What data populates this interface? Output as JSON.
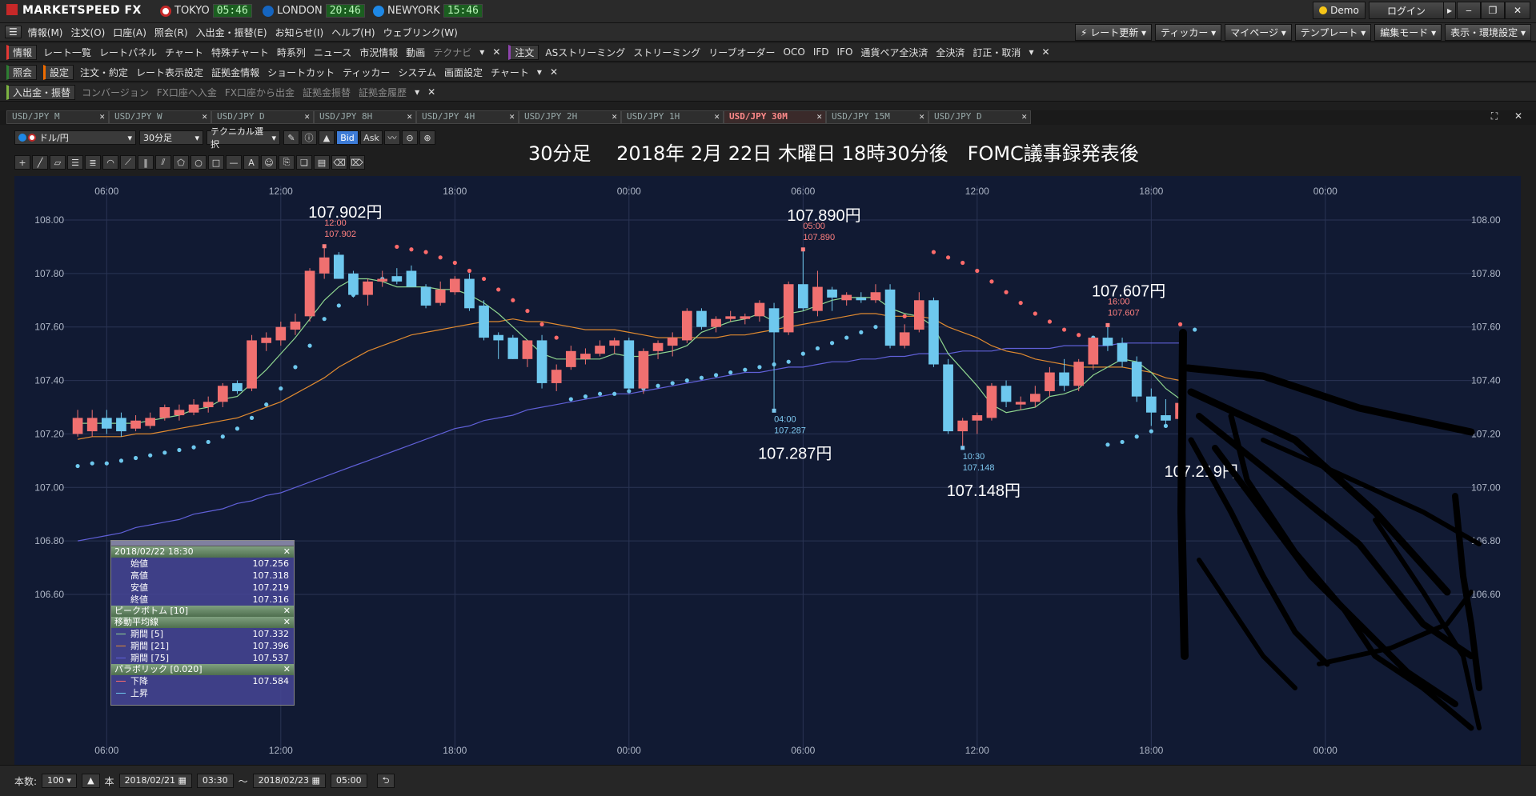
{
  "app": {
    "name": "MARKETSPEED FX",
    "clocks": [
      {
        "city": "TOKYO",
        "time": "05:46",
        "flag_color": "#c62828"
      },
      {
        "city": "LONDON",
        "time": "20:46",
        "flag_color": "#1565c0"
      },
      {
        "city": "NEWYORK",
        "time": "15:46",
        "flag_color": "#1e88e5"
      }
    ],
    "demo_label": "Demo",
    "login_label": "ログイン",
    "menu": [
      "情報(M)",
      "注文(O)",
      "口座(A)",
      "照会(R)",
      "入出金・振替(E)",
      "お知らせ(I)",
      "ヘルプ(H)",
      "ウェブリンク(W)"
    ],
    "right_buttons": [
      "レート更新",
      "ティッカー",
      "マイページ",
      "テンプレート",
      "編集モード",
      "表示・環境設定"
    ]
  },
  "toolbar1": {
    "section1_label": "情報",
    "items1": [
      "レート一覧",
      "レートパネル",
      "チャート",
      "特殊チャート",
      "時系列",
      "ニュース",
      "市況情報",
      "動画"
    ],
    "dim_item": "テクナビ",
    "section2_label": "注文",
    "items2": [
      "ASストリーミング",
      "ストリーミング",
      "リーブオーダー",
      "OCO",
      "IFD",
      "IFO",
      "通貨ペア全決済",
      "全決済",
      "訂正・取消"
    ]
  },
  "toolbar2": {
    "section1_label": "照会",
    "section2_label": "設定",
    "items": [
      "注文・約定",
      "レート表示設定",
      "証拠金情報",
      "ショートカット",
      "ティッカー",
      "システム",
      "画面設定",
      "チャート"
    ]
  },
  "toolbar3": {
    "section_label": "入出金・振替",
    "items": [
      "コンバージョン",
      "FX口座へ入金",
      "FX口座から出金",
      "証拠金振替",
      "証拠金履歴"
    ]
  },
  "tabs": [
    {
      "label": "USD/JPY M",
      "active": false
    },
    {
      "label": "USD/JPY W",
      "active": false
    },
    {
      "label": "USD/JPY D",
      "active": false
    },
    {
      "label": "USD/JPY 8H",
      "active": false
    },
    {
      "label": "USD/JPY 4H",
      "active": false
    },
    {
      "label": "USD/JPY 2H",
      "active": false
    },
    {
      "label": "USD/JPY 1H",
      "active": false
    },
    {
      "label": "USD/JPY 30M",
      "active": true
    },
    {
      "label": "USD/JPY 15M",
      "active": false
    },
    {
      "label": "USD/JPY D",
      "active": false
    }
  ],
  "chart_toolbar": {
    "pair": "ドル/円",
    "timeframe": "30分足",
    "technical": "テクニカル選択",
    "bid": "Bid",
    "ask": "Ask"
  },
  "chart_title": "30分足　 2018年 2月 22日 木曜日 18時30分後　FOMC議事録発表後",
  "chart_data": {
    "type": "candlestick",
    "ylim": [
      106.5,
      108.1
    ],
    "yticks": [
      106.6,
      106.8,
      107.0,
      107.2,
      107.4,
      107.6,
      107.8,
      108.0
    ],
    "ytick_labels": [
      "106.60",
      "106.80",
      "107.00",
      "107.20",
      "107.40",
      "107.60",
      "107.80",
      "108.00"
    ],
    "xtick_labels": [
      "06:00",
      "12:00",
      "18:00",
      "00:00",
      "06:00",
      "12:00",
      "18:00",
      "00:00"
    ],
    "xtick_index": [
      2,
      14,
      26,
      38,
      50,
      62,
      74,
      86
    ],
    "n_slots": 96,
    "candles": [
      {
        "o": 107.2,
        "h": 107.29,
        "l": 107.19,
        "c": 107.26
      },
      {
        "o": 107.21,
        "h": 107.29,
        "l": 107.19,
        "c": 107.26
      },
      {
        "o": 107.26,
        "h": 107.29,
        "l": 107.2,
        "c": 107.22
      },
      {
        "o": 107.26,
        "h": 107.28,
        "l": 107.19,
        "c": 107.21
      },
      {
        "o": 107.22,
        "h": 107.27,
        "l": 107.21,
        "c": 107.25
      },
      {
        "o": 107.23,
        "h": 107.28,
        "l": 107.22,
        "c": 107.26
      },
      {
        "o": 107.26,
        "h": 107.31,
        "l": 107.25,
        "c": 107.3
      },
      {
        "o": 107.27,
        "h": 107.31,
        "l": 107.25,
        "c": 107.29
      },
      {
        "o": 107.28,
        "h": 107.33,
        "l": 107.27,
        "c": 107.31
      },
      {
        "o": 107.3,
        "h": 107.34,
        "l": 107.28,
        "c": 107.32
      },
      {
        "o": 107.32,
        "h": 107.39,
        "l": 107.3,
        "c": 107.38
      },
      {
        "o": 107.39,
        "h": 107.4,
        "l": 107.35,
        "c": 107.36
      },
      {
        "o": 107.37,
        "h": 107.57,
        "l": 107.36,
        "c": 107.55
      },
      {
        "o": 107.54,
        "h": 107.58,
        "l": 107.51,
        "c": 107.56
      },
      {
        "o": 107.55,
        "h": 107.62,
        "l": 107.53,
        "c": 107.6
      },
      {
        "o": 107.59,
        "h": 107.65,
        "l": 107.57,
        "c": 107.62
      },
      {
        "o": 107.64,
        "h": 107.82,
        "l": 107.62,
        "c": 107.81
      },
      {
        "o": 107.8,
        "h": 107.902,
        "l": 107.78,
        "c": 107.86
      },
      {
        "o": 107.87,
        "h": 107.88,
        "l": 107.78,
        "c": 107.78
      },
      {
        "o": 107.8,
        "h": 107.81,
        "l": 107.71,
        "c": 107.72
      },
      {
        "o": 107.72,
        "h": 107.78,
        "l": 107.68,
        "c": 107.77
      },
      {
        "o": 107.77,
        "h": 107.81,
        "l": 107.75,
        "c": 107.78
      },
      {
        "o": 107.79,
        "h": 107.82,
        "l": 107.76,
        "c": 107.77
      },
      {
        "o": 107.81,
        "h": 107.83,
        "l": 107.75,
        "c": 107.75
      },
      {
        "o": 107.75,
        "h": 107.76,
        "l": 107.67,
        "c": 107.68
      },
      {
        "o": 107.69,
        "h": 107.77,
        "l": 107.68,
        "c": 107.74
      },
      {
        "o": 107.73,
        "h": 107.79,
        "l": 107.72,
        "c": 107.78
      },
      {
        "o": 107.78,
        "h": 107.8,
        "l": 107.66,
        "c": 107.67
      },
      {
        "o": 107.68,
        "h": 107.7,
        "l": 107.55,
        "c": 107.56
      },
      {
        "o": 107.57,
        "h": 107.58,
        "l": 107.48,
        "c": 107.55
      },
      {
        "o": 107.56,
        "h": 107.57,
        "l": 107.48,
        "c": 107.48
      },
      {
        "o": 107.48,
        "h": 107.55,
        "l": 107.45,
        "c": 107.55
      },
      {
        "o": 107.55,
        "h": 107.57,
        "l": 107.37,
        "c": 107.39
      },
      {
        "o": 107.39,
        "h": 107.46,
        "l": 107.36,
        "c": 107.44
      },
      {
        "o": 107.45,
        "h": 107.53,
        "l": 107.44,
        "c": 107.51
      },
      {
        "o": 107.48,
        "h": 107.52,
        "l": 107.46,
        "c": 107.5
      },
      {
        "o": 107.5,
        "h": 107.55,
        "l": 107.49,
        "c": 107.53
      },
      {
        "o": 107.53,
        "h": 107.56,
        "l": 107.5,
        "c": 107.55
      },
      {
        "o": 107.55,
        "h": 107.56,
        "l": 107.36,
        "c": 107.37
      },
      {
        "o": 107.37,
        "h": 107.52,
        "l": 107.35,
        "c": 107.51
      },
      {
        "o": 107.51,
        "h": 107.55,
        "l": 107.48,
        "c": 107.54
      },
      {
        "o": 107.53,
        "h": 107.58,
        "l": 107.49,
        "c": 107.56
      },
      {
        "o": 107.55,
        "h": 107.67,
        "l": 107.54,
        "c": 107.66
      },
      {
        "o": 107.66,
        "h": 107.67,
        "l": 107.59,
        "c": 107.6
      },
      {
        "o": 107.6,
        "h": 107.64,
        "l": 107.58,
        "c": 107.63
      },
      {
        "o": 107.63,
        "h": 107.66,
        "l": 107.62,
        "c": 107.64
      },
      {
        "o": 107.63,
        "h": 107.65,
        "l": 107.61,
        "c": 107.64
      },
      {
        "o": 107.64,
        "h": 107.7,
        "l": 107.62,
        "c": 107.69
      },
      {
        "o": 107.67,
        "h": 107.69,
        "l": 107.287,
        "c": 107.58
      },
      {
        "o": 107.58,
        "h": 107.77,
        "l": 107.57,
        "c": 107.76
      },
      {
        "o": 107.76,
        "h": 107.89,
        "l": 107.66,
        "c": 107.67
      },
      {
        "o": 107.66,
        "h": 107.81,
        "l": 107.64,
        "c": 107.75
      },
      {
        "o": 107.74,
        "h": 107.75,
        "l": 107.66,
        "c": 107.71
      },
      {
        "o": 107.7,
        "h": 107.73,
        "l": 107.68,
        "c": 107.72
      },
      {
        "o": 107.71,
        "h": 107.73,
        "l": 107.69,
        "c": 107.7
      },
      {
        "o": 107.7,
        "h": 107.76,
        "l": 107.69,
        "c": 107.73
      },
      {
        "o": 107.74,
        "h": 107.76,
        "l": 107.52,
        "c": 107.53
      },
      {
        "o": 107.53,
        "h": 107.61,
        "l": 107.52,
        "c": 107.58
      },
      {
        "o": 107.59,
        "h": 107.73,
        "l": 107.58,
        "c": 107.7
      },
      {
        "o": 107.7,
        "h": 107.71,
        "l": 107.45,
        "c": 107.46
      },
      {
        "o": 107.46,
        "h": 107.48,
        "l": 107.2,
        "c": 107.21
      },
      {
        "o": 107.21,
        "h": 107.26,
        "l": 107.148,
        "c": 107.25
      },
      {
        "o": 107.25,
        "h": 107.28,
        "l": 107.2,
        "c": 107.27
      },
      {
        "o": 107.26,
        "h": 107.39,
        "l": 107.25,
        "c": 107.38
      },
      {
        "o": 107.38,
        "h": 107.4,
        "l": 107.3,
        "c": 107.32
      },
      {
        "o": 107.31,
        "h": 107.34,
        "l": 107.29,
        "c": 107.32
      },
      {
        "o": 107.32,
        "h": 107.38,
        "l": 107.3,
        "c": 107.35
      },
      {
        "o": 107.36,
        "h": 107.45,
        "l": 107.34,
        "c": 107.43
      },
      {
        "o": 107.43,
        "h": 107.48,
        "l": 107.36,
        "c": 107.38
      },
      {
        "o": 107.38,
        "h": 107.48,
        "l": 107.36,
        "c": 107.47
      },
      {
        "o": 107.46,
        "h": 107.56,
        "l": 107.44,
        "c": 107.56
      },
      {
        "o": 107.56,
        "h": 107.607,
        "l": 107.51,
        "c": 107.53
      },
      {
        "o": 107.54,
        "h": 107.56,
        "l": 107.45,
        "c": 107.47
      },
      {
        "o": 107.47,
        "h": 107.49,
        "l": 107.32,
        "c": 107.34
      },
      {
        "o": 107.34,
        "h": 107.37,
        "l": 107.23,
        "c": 107.28
      },
      {
        "o": 107.27,
        "h": 107.33,
        "l": 107.23,
        "c": 107.25
      },
      {
        "o": 107.256,
        "h": 107.318,
        "l": 107.219,
        "c": 107.316
      }
    ],
    "ma5": [
      107.24,
      107.24,
      107.24,
      107.24,
      107.24,
      107.25,
      107.26,
      107.27,
      107.29,
      107.3,
      107.33,
      107.34,
      107.39,
      107.44,
      107.5,
      107.56,
      107.63,
      107.7,
      107.75,
      107.78,
      107.78,
      107.77,
      107.75,
      107.75,
      107.75,
      107.74,
      107.74,
      107.72,
      107.69,
      107.65,
      107.6,
      107.55,
      107.5,
      107.48,
      107.48,
      107.48,
      107.48,
      107.5,
      107.49,
      107.49,
      107.5,
      107.51,
      107.53,
      107.58,
      107.6,
      107.62,
      107.63,
      107.65,
      107.62,
      107.65,
      107.66,
      107.68,
      107.7,
      107.71,
      107.71,
      107.71,
      107.67,
      107.65,
      107.64,
      107.6,
      107.5,
      107.44,
      107.38,
      107.31,
      107.28,
      107.29,
      107.3,
      107.34,
      107.35,
      107.37,
      107.42,
      107.45,
      107.48,
      107.47,
      107.43,
      107.37,
      107.33
    ],
    "ma21": [
      107.18,
      107.19,
      107.19,
      107.19,
      107.2,
      107.2,
      107.21,
      107.22,
      107.23,
      107.24,
      107.25,
      107.26,
      107.28,
      107.3,
      107.32,
      107.35,
      107.38,
      107.41,
      107.45,
      107.48,
      107.51,
      107.53,
      107.55,
      107.57,
      107.58,
      107.59,
      107.6,
      107.61,
      107.62,
      107.62,
      107.63,
      107.62,
      107.62,
      107.61,
      107.6,
      107.59,
      107.59,
      107.59,
      107.58,
      107.57,
      107.56,
      107.56,
      107.56,
      107.56,
      107.56,
      107.57,
      107.57,
      107.58,
      107.59,
      107.6,
      107.61,
      107.62,
      107.63,
      107.64,
      107.65,
      107.65,
      107.64,
      107.64,
      107.64,
      107.63,
      107.6,
      107.58,
      107.56,
      107.53,
      107.51,
      107.5,
      107.48,
      107.47,
      107.46,
      107.45,
      107.45,
      107.45,
      107.45,
      107.44,
      107.43,
      107.41,
      107.4
    ],
    "ma75": [
      106.8,
      106.81,
      106.82,
      106.83,
      106.85,
      106.86,
      106.87,
      106.88,
      106.9,
      106.91,
      106.92,
      106.94,
      106.95,
      106.97,
      106.98,
      107.0,
      107.02,
      107.04,
      107.06,
      107.08,
      107.1,
      107.12,
      107.14,
      107.16,
      107.18,
      107.2,
      107.22,
      107.23,
      107.25,
      107.26,
      107.27,
      107.29,
      107.3,
      107.31,
      107.32,
      107.33,
      107.34,
      107.35,
      107.35,
      107.36,
      107.37,
      107.38,
      107.39,
      107.4,
      107.41,
      107.42,
      107.43,
      107.43,
      107.44,
      107.45,
      107.45,
      107.46,
      107.47,
      107.47,
      107.48,
      107.48,
      107.49,
      107.49,
      107.5,
      107.5,
      107.5,
      107.51,
      107.51,
      107.51,
      107.52,
      107.52,
      107.52,
      107.52,
      107.53,
      107.53,
      107.53,
      107.53,
      107.54,
      107.54,
      107.54,
      107.54,
      107.54
    ],
    "sar": [
      107.08,
      107.09,
      107.09,
      107.1,
      107.11,
      107.12,
      107.13,
      107.14,
      107.15,
      107.17,
      107.19,
      107.22,
      107.26,
      107.31,
      107.37,
      107.45,
      107.53,
      107.63,
      107.68,
      107.72,
      107.75,
      107.78,
      107.9,
      107.89,
      107.88,
      107.86,
      107.84,
      107.81,
      107.78,
      107.74,
      107.7,
      107.66,
      107.61,
      107.56,
      107.33,
      107.34,
      107.35,
      107.35,
      107.36,
      107.37,
      107.38,
      107.39,
      107.4,
      107.41,
      107.42,
      107.43,
      107.44,
      107.45,
      107.46,
      107.47,
      107.5,
      107.52,
      107.54,
      107.56,
      107.58,
      107.6,
      107.62,
      107.64,
      107.66,
      107.88,
      107.86,
      107.84,
      107.81,
      107.77,
      107.73,
      107.69,
      107.65,
      107.62,
      107.59,
      107.57,
      107.56,
      107.16,
      107.17,
      107.19,
      107.21,
      107.23,
      107.61,
      107.59
    ],
    "annotations": [
      {
        "idx": 17,
        "price": 107.902,
        "big": "107.902円",
        "time": "12:00",
        "val": "107.902",
        "pos": "top"
      },
      {
        "idx": 50,
        "price": 107.89,
        "big": "107.890円",
        "time": "05:00",
        "val": "107.890",
        "pos": "top"
      },
      {
        "idx": 48,
        "price": 107.287,
        "big": "107.287円",
        "time": "04:00",
        "val": "107.287",
        "pos": "bottom"
      },
      {
        "idx": 61,
        "price": 107.148,
        "big": "107.148円",
        "time": "10:30",
        "val": "107.148",
        "pos": "bottom"
      },
      {
        "idx": 71,
        "price": 107.607,
        "big": "107.607円",
        "time": "16:00",
        "val": "107.607",
        "pos": "top"
      },
      {
        "idx": 76,
        "price": 107.219,
        "big": "107.219円",
        "time": "",
        "val": "",
        "pos": "bottom"
      }
    ],
    "colors": {
      "up": "#f07070",
      "down": "#6ec8ee",
      "ma5": "#8fd68f",
      "ma21": "#e08a30",
      "ma75": "#6060d8",
      "sar": "#ff6b6b",
      "sar_up": "#6ec8ee",
      "bg": "#111a33",
      "grid": "#2a3454"
    }
  },
  "info_panel": {
    "datetime": "2018/02/22 18:30",
    "ohlc": [
      {
        "label": "始値",
        "value": "107.256"
      },
      {
        "label": "高値",
        "value": "107.318"
      },
      {
        "label": "安値",
        "value": "107.219"
      },
      {
        "label": "終値",
        "value": "107.316"
      }
    ],
    "peak_bottom": "ピークボトム [10]",
    "ma_title": "移動平均線",
    "ma": [
      {
        "label": "期間 [5]",
        "value": "107.332",
        "color": "#8fd68f"
      },
      {
        "label": "期間 [21]",
        "value": "107.396",
        "color": "#e08a30"
      },
      {
        "label": "期間 [75]",
        "value": "107.537",
        "color": "#6060d8"
      }
    ],
    "parabolic_title": "パラボリック [0.020]",
    "parabolic": [
      {
        "label": "下降",
        "value": "107.584",
        "color": "#ff6b6b"
      },
      {
        "label": "上昇",
        "value": "",
        "color": "#6ec8ee"
      }
    ]
  },
  "status_bar": {
    "count_label": "本数:",
    "count_value": "100",
    "unit": "本",
    "start_date": "2018/02/21",
    "start_time": "03:30",
    "tilde": "〜",
    "end_date": "2018/02/23",
    "end_time": "05:00"
  }
}
